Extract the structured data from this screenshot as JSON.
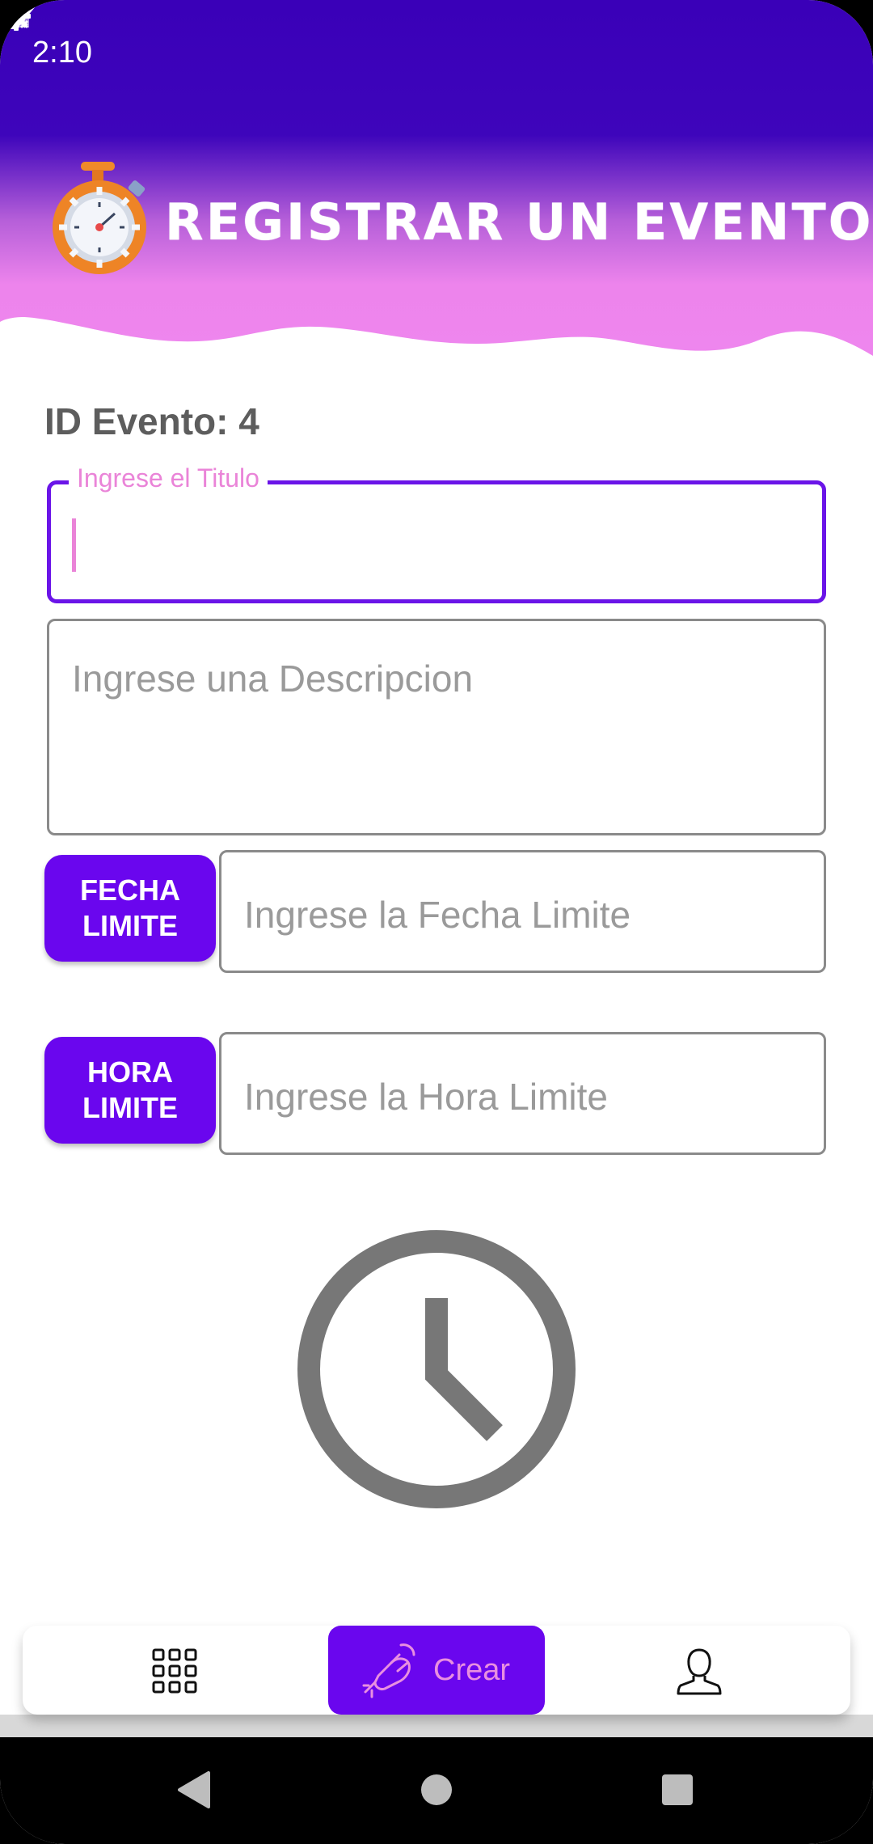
{
  "status_bar": {
    "time": "2:10",
    "icons": [
      "gear-icon",
      "wifi-icon",
      "signal-icon",
      "battery-icon"
    ]
  },
  "header": {
    "title": "REGISTRAR UN EVENTO",
    "icon": "stopwatch-icon",
    "gradient_top": "#3a00b8",
    "gradient_bottom": "#ed84ec"
  },
  "form": {
    "event_id_label": "ID Evento: 4",
    "title_field": {
      "label": "Ingrese el Titulo",
      "value": ""
    },
    "description_field": {
      "placeholder": "Ingrese una Descripcion",
      "value": ""
    },
    "fecha_button_label": "FECHA\nLIMITE",
    "fecha_line1": "FECHA",
    "fecha_line2": "LIMITE",
    "fecha_field": {
      "placeholder": "Ingrese la Fecha Limite",
      "value": ""
    },
    "hora_line1": "HORA",
    "hora_line2": "LIMITE",
    "hora_field": {
      "placeholder": "Ingrese la Hora Limite",
      "value": ""
    }
  },
  "bottom_nav": {
    "items": [
      {
        "icon": "grid-icon",
        "label": ""
      },
      {
        "icon": "plug-icon",
        "label": "Crear",
        "selected": true
      },
      {
        "icon": "profile-icon",
        "label": ""
      }
    ]
  },
  "colors": {
    "accent": "#6a06ee",
    "label_pink": "#ea84d8",
    "text_gray": "#5d5d5d"
  }
}
